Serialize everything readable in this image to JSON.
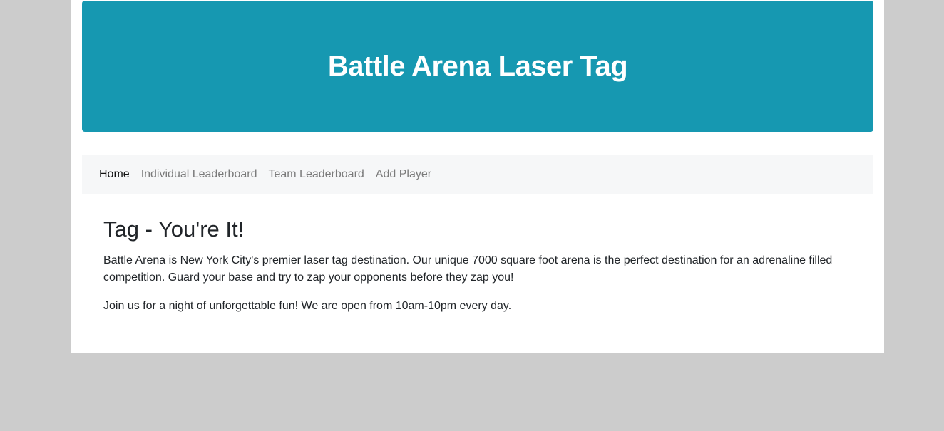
{
  "hero": {
    "title": "Battle Arena Laser Tag",
    "background_color": "#1698b1"
  },
  "nav": {
    "items": [
      {
        "label": "Home",
        "active": true
      },
      {
        "label": "Individual Leaderboard",
        "active": false
      },
      {
        "label": "Team Leaderboard",
        "active": false
      },
      {
        "label": "Add Player",
        "active": false
      }
    ]
  },
  "main": {
    "heading": "Tag - You're It!",
    "paragraphs": [
      "Battle Arena is New York City's premier laser tag destination. Our unique 7000 square foot arena is the perfect destination for an adrenaline filled competition. Guard your base and try to zap your opponents before they zap you!",
      "Join us for a night of unforgettable fun! We are open from 10am-10pm every day."
    ]
  }
}
